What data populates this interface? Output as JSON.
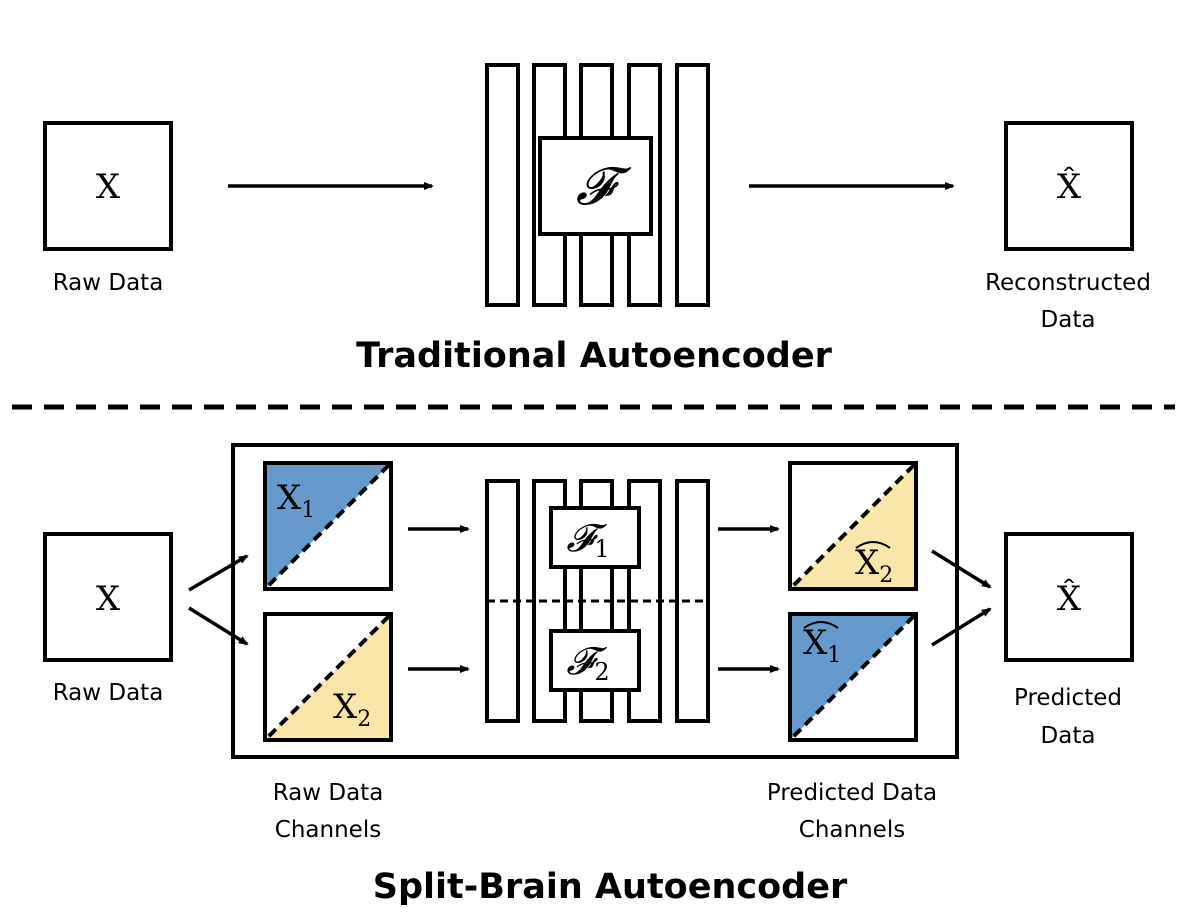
{
  "traditional": {
    "title": "Traditional Autoencoder",
    "input": {
      "symbol": "X",
      "label": "Raw Data"
    },
    "network": {
      "symbol": "𝓕"
    },
    "output": {
      "symbol": "X̂",
      "label_line1": "Reconstructed",
      "label_line2": "Data"
    }
  },
  "split_brain": {
    "title": "Split-Brain Autoencoder",
    "input": {
      "symbol": "X",
      "label": "Raw Data"
    },
    "raw_channels": {
      "top": {
        "symbol": "X",
        "subscript": "1"
      },
      "bottom": {
        "symbol": "X",
        "subscript": "2"
      },
      "label_line1": "Raw Data",
      "label_line2": "Channels"
    },
    "networks": {
      "top": {
        "symbol": "𝓕",
        "subscript": "1"
      },
      "bottom": {
        "symbol": "𝓕",
        "subscript": "2"
      }
    },
    "predicted_channels": {
      "top": {
        "symbol": "X",
        "subscript": "2",
        "hat": "‸"
      },
      "bottom": {
        "symbol": "X",
        "subscript": "1",
        "hat": "‸"
      },
      "label_line1": "Predicted Data",
      "label_line2": "Channels"
    },
    "output": {
      "symbol": "X̂",
      "label_line1": "Predicted",
      "label_line2": "Data"
    }
  },
  "colors": {
    "channel_1": "#6699cc",
    "channel_2": "#fae6a8",
    "stroke": "#000000"
  }
}
